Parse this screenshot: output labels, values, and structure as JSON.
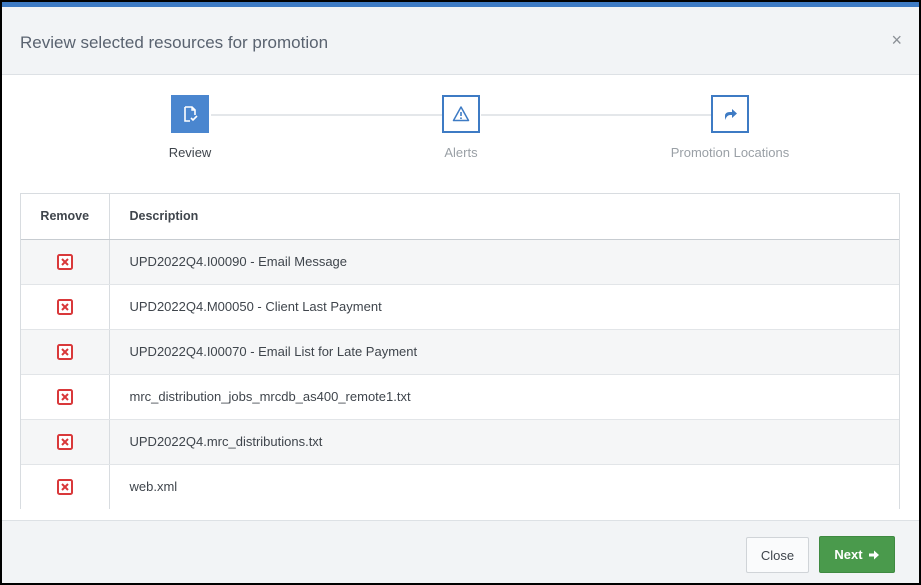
{
  "dialog": {
    "title": "Review selected resources for promotion",
    "close_glyph": "×"
  },
  "steps": [
    {
      "label": "Review",
      "icon": "review-document-icon",
      "active": true
    },
    {
      "label": "Alerts",
      "icon": "warning-triangle-icon",
      "active": false
    },
    {
      "label": "Promotion Locations",
      "icon": "share-arrow-icon",
      "active": false
    }
  ],
  "table": {
    "columns": [
      "Remove",
      "Description"
    ],
    "rows": [
      {
        "description": "UPD2022Q4.I00090 - Email Message"
      },
      {
        "description": "UPD2022Q4.M00050 - Client Last Payment"
      },
      {
        "description": "UPD2022Q4.I00070 - Email List for Late Payment"
      },
      {
        "description": "mrc_distribution_jobs_mrcdb_as400_remote1.txt"
      },
      {
        "description": "UPD2022Q4.mrc_distributions.txt"
      },
      {
        "description": "web.xml"
      }
    ]
  },
  "footer": {
    "close_label": "Close",
    "next_label": "Next"
  },
  "colors": {
    "accent": "#3e7bc4",
    "remove_red": "#d9383a",
    "next_green": "#4a9a4c"
  }
}
